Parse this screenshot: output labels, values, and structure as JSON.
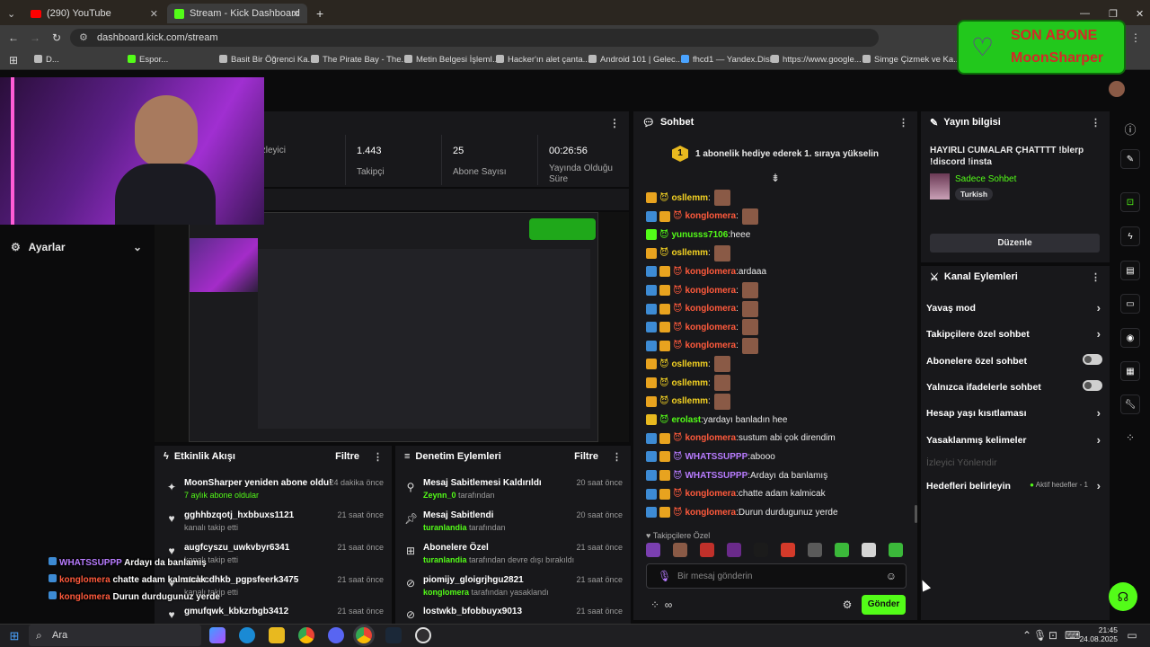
{
  "browser": {
    "tabs": [
      {
        "label": "(290) YouTube"
      },
      {
        "label": "Stream - Kick Dashboard"
      }
    ],
    "url": "dashboard.kick.com/stream",
    "bookmarks": [
      "D...",
      "Espor...",
      "Basit Bir Öğrenci Ka...",
      "The Pirate Bay - The...",
      "Metin Belgesi İşlemI...",
      "Hacker'ın alet çanta...",
      "Android 101 | Gelec...",
      "fhcd1 — Yandex.Disk",
      "https://www.google...",
      "Simge Çizmek ve Ka..."
    ]
  },
  "overlay_sub": {
    "title": "SON ABONE",
    "name": "MoonSharper"
  },
  "sidebar": {
    "settings_label": "Ayarlar"
  },
  "stats": [
    {
      "value": "",
      "label": "İzleyici"
    },
    {
      "value": "1.443",
      "label": "Takipçi"
    },
    {
      "value": "25",
      "label": "Abone Sayısı"
    },
    {
      "value": "00:26:56",
      "label": "Yayında Olduğu Süre"
    }
  ],
  "activity": {
    "title": "Etkinlik Akışı",
    "filter": "Filtre",
    "items": [
      {
        "title": "MoonSharper yeniden abone oldu!",
        "sub": "7 aylık abone oldular",
        "time": "24 dakika önce"
      },
      {
        "title": "gghhbzqotj_hxbbuxs1121",
        "sub": "kanalı takip etti",
        "time": "21 saat önce"
      },
      {
        "title": "augfcyszu_uwkvbyr6341",
        "sub": "kanalı takip etti",
        "time": "21 saat önce"
      },
      {
        "title": "ztclecdhkb_pgpsfeerk3475",
        "sub": "kanalı takip etti",
        "time": "21 saat önce"
      },
      {
        "title": "gmufqwk_kbkzrbgb3412",
        "sub": "",
        "time": "21 saat önce"
      }
    ]
  },
  "moderation": {
    "title": "Denetim Eylemleri",
    "filter": "Filtre",
    "items": [
      {
        "title": "Mesaj Sabitlemesi Kaldırıldı",
        "user": "Zeynn_0",
        "action": "tarafından",
        "time": "20 saat önce"
      },
      {
        "title": "Mesaj Sabitlendi",
        "user": "turanlandia",
        "action": "tarafından",
        "time": "20 saat önce"
      },
      {
        "title": "Abonelere Özel",
        "user": "turanlandia",
        "action": "tarafından devre dışı bırakıldı",
        "time": "21 saat önce"
      },
      {
        "title": "piomijy_gloigrjhgu2821",
        "user": "konglomera",
        "action": "tarafından yasaklandı",
        "time": "21 saat önce"
      },
      {
        "title": "lostwkb_bfobbuyx9013",
        "user": "",
        "action": "",
        "time": "21 saat önce"
      }
    ]
  },
  "chat": {
    "title": "Sohbet",
    "pinned": "1 abonelik hediye ederek 1. sıraya yükselin",
    "pinned_num": "1",
    "messages": [
      {
        "user": "osllemm",
        "color": "#f5d323",
        "text": "",
        "emote": true
      },
      {
        "user": "konglomera",
        "color": "#ff5a3c",
        "text": "",
        "emote": true
      },
      {
        "user": "yunusss7106",
        "color": "#53fc18",
        "text": "heee",
        "emote": false
      },
      {
        "user": "osllemm",
        "color": "#f5d323",
        "text": "",
        "emote": true
      },
      {
        "user": "konglomera",
        "color": "#ff5a3c",
        "text": "ardaaa",
        "emote": false
      },
      {
        "user": "konglomera",
        "color": "#ff5a3c",
        "text": "",
        "emote": true
      },
      {
        "user": "konglomera",
        "color": "#ff5a3c",
        "text": "",
        "emote": true
      },
      {
        "user": "konglomera",
        "color": "#ff5a3c",
        "text": "",
        "emote": true
      },
      {
        "user": "konglomera",
        "color": "#ff5a3c",
        "text": "",
        "emote": true
      },
      {
        "user": "osllemm",
        "color": "#f5d323",
        "text": "",
        "emote": true
      },
      {
        "user": "osllemm",
        "color": "#f5d323",
        "text": "",
        "emote": true
      },
      {
        "user": "osllemm",
        "color": "#f5d323",
        "text": "",
        "emote": true
      },
      {
        "user": "erolast",
        "color": "#53fc18",
        "text": "yardayı banladın hee",
        "emote": false
      },
      {
        "user": "konglomera",
        "color": "#ff5a3c",
        "text": "sustum abi çok direndim",
        "emote": false
      },
      {
        "user": "WHATSSUPPP",
        "color": "#b87cff",
        "text": "abooo",
        "emote": false
      },
      {
        "user": "WHATSSUPPP",
        "color": "#b87cff",
        "text": "Ardayı da banlamış",
        "emote": false
      },
      {
        "user": "konglomera",
        "color": "#ff5a3c",
        "text": "chatte adam kalmicak",
        "emote": false
      },
      {
        "user": "konglomera",
        "color": "#ff5a3c",
        "text": "Durun durdugunuz yerde",
        "emote": false
      }
    ],
    "emote_bar_label": "Takipçilere Özel",
    "input_placeholder": "Bir mesaj gönderin",
    "send_label": "Gönder"
  },
  "stream_info": {
    "title": "Yayın bilgisi",
    "stream_title": "HAYIRLI CUMALAR ÇHATTTT !blerp !discord !insta",
    "category": "Sadece Sohbet",
    "tag": "Turkish",
    "edit_label": "Düzenle"
  },
  "channel_actions": {
    "title": "Kanal Eylemleri",
    "rows": [
      {
        "label": "Yavaş mod",
        "kind": "chevron"
      },
      {
        "label": "Takipçilere özel sohbet",
        "kind": "chevron"
      },
      {
        "label": "Abonelere özel sohbet",
        "kind": "toggle"
      },
      {
        "label": "Yalnızca ifadelerle sohbet",
        "kind": "toggle"
      },
      {
        "label": "Hesap yaşı kısıtlaması",
        "kind": "chevron"
      },
      {
        "label": "Yasaklanmış kelimeler",
        "kind": "chevron"
      }
    ],
    "disabled_row": "İzleyici Yönlendir",
    "goals_label": "Hedefleri belirleyin",
    "goals_status": "Aktif hedefler - 1"
  },
  "stream_overlay_chat": [
    {
      "user": "WHATSSUPPP",
      "text": "Ardayı da banlamış"
    },
    {
      "user": "konglomera",
      "text": "chatte adam kalmıcak"
    },
    {
      "user": "konglomera",
      "text": "Durun durdugunuz yerde"
    }
  ],
  "taskbar": {
    "search": "Ara",
    "time": "21:45",
    "date": "24.08.2025"
  },
  "colors": {
    "kick_green": "#53fc18",
    "panel": "#18181b",
    "bg": "#0b0b0c"
  }
}
